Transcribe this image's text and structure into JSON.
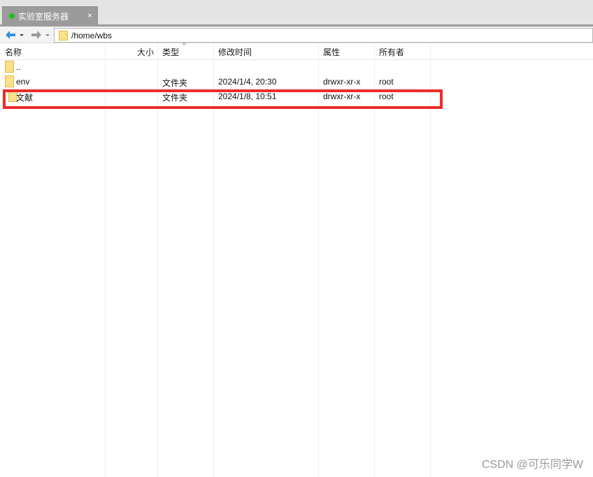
{
  "tab": {
    "title": "实验室服务器",
    "close_label": "×",
    "status_color": "#16c01e"
  },
  "address": {
    "path": "/home/wbs"
  },
  "columns": {
    "name": "名称",
    "size": "大小",
    "type": "类型",
    "modified": "修改时间",
    "permissions": "属性",
    "owner": "所有者"
  },
  "sort_indicator": "^",
  "files": [
    {
      "name": "..",
      "size": "",
      "type": "",
      "modified": "",
      "permissions": "",
      "owner": ""
    },
    {
      "name": "env",
      "size": "",
      "type": "文件夹",
      "modified": "2024/1/4, 20:30",
      "permissions": "drwxr-xr-x",
      "owner": "root"
    },
    {
      "name": "文献",
      "size": "",
      "type": "文件夹",
      "modified": "2024/1/8, 10:51",
      "permissions": "drwxr-xr-x",
      "owner": "root"
    }
  ],
  "annotation_color": "#ef2b2b",
  "watermark": "CSDN @可乐同学W"
}
